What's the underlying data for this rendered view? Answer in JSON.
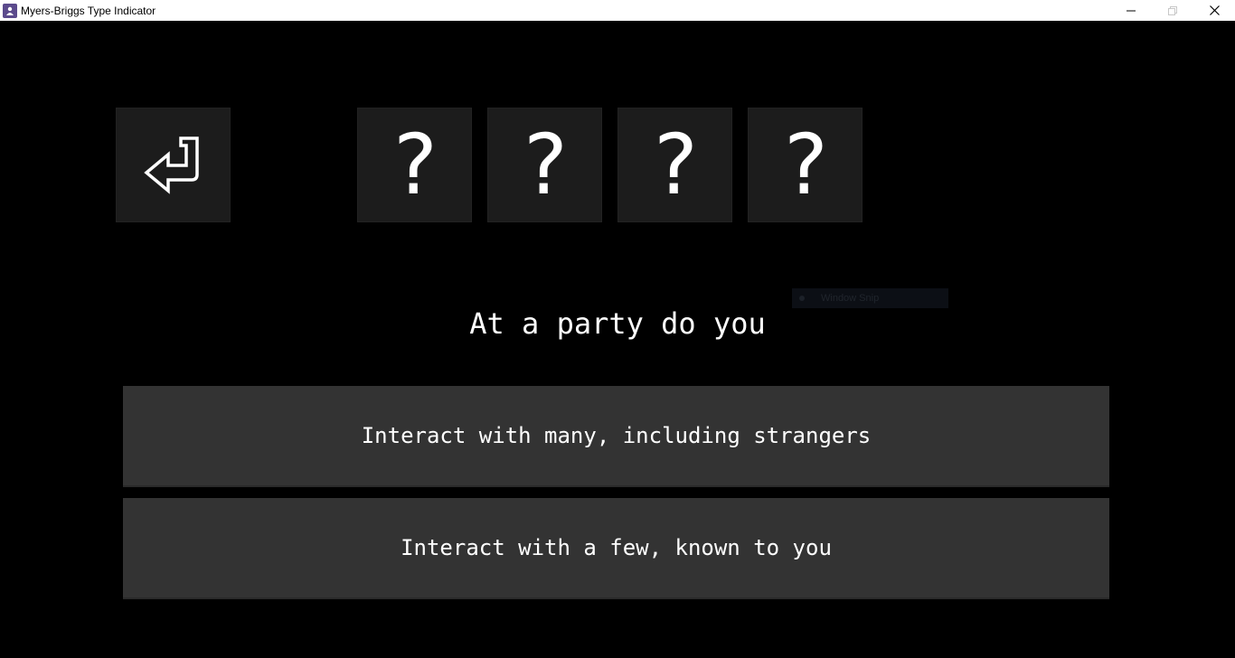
{
  "window": {
    "title": "Myers-Briggs Type Indicator"
  },
  "colors": {
    "background": "#000000",
    "tile": "#1c1c1c",
    "answer_button": "#333333",
    "text": "#ffffff"
  },
  "back_button": {
    "icon": "return-arrow-icon"
  },
  "type_slots": [
    "?",
    "?",
    "?",
    "?"
  ],
  "question": {
    "text": "At a party do you"
  },
  "answers": [
    {
      "label": "Interact with many, including strangers"
    },
    {
      "label": "Interact with a few, known to you"
    }
  ],
  "overlay": {
    "label": "Window Snip"
  }
}
